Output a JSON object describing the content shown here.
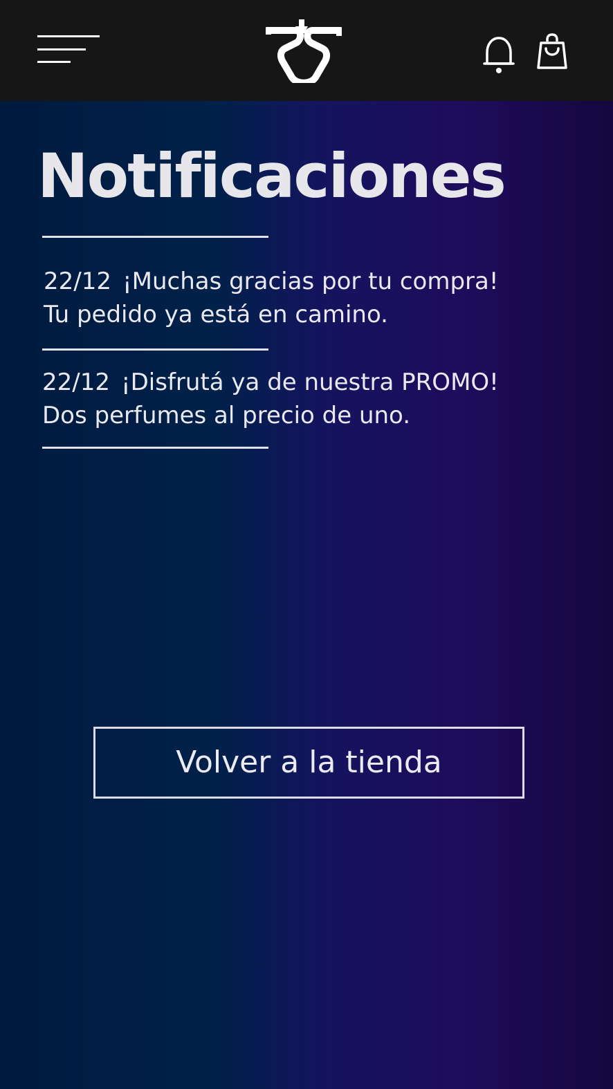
{
  "header": {
    "menu_icon": "hamburger-menu-icon",
    "logo_icon": "perfume-brand-logo",
    "bell_icon": "bell-icon",
    "bag_icon": "shopping-bag-icon"
  },
  "page": {
    "title": "Notificaciones"
  },
  "notifications": [
    {
      "date": "22/12",
      "headline": "¡Muchas gracias por tu compra!",
      "body": "Tu pedido ya está en camino."
    },
    {
      "date": "22/12",
      "headline": "¡Disfrutá ya de nuestra PROMO!",
      "body": "Dos perfumes al precio de uno."
    }
  ],
  "actions": {
    "back_to_store_label": "Volver a la tienda"
  },
  "colors": {
    "topbar": "#161616",
    "gradient_left": "#001a3e",
    "gradient_right": "#15073f",
    "text": "#e8e6ee"
  }
}
